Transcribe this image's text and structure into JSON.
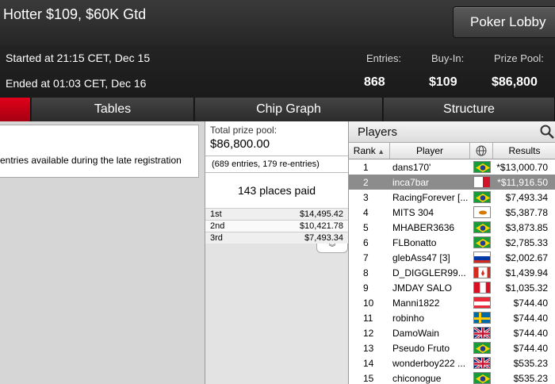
{
  "header": {
    "title": "Hotter $109, $60K Gtd",
    "lobby_button": "Poker Lobby",
    "started": "Started at 21:15 CET, Dec 15",
    "ended": "Ended at 01:03 CET, Dec 16",
    "stats": {
      "entries_label": "Entries:",
      "entries_value": "868",
      "buyin_label": "Buy-In:",
      "buyin_value": "$109",
      "prizepool_label": "Prize Pool:",
      "prizepool_value": "$86,800"
    }
  },
  "tabs": [
    {
      "label": ""
    },
    {
      "label": "Tables"
    },
    {
      "label": "Chip Graph"
    },
    {
      "label": "Structure"
    }
  ],
  "late_reg": {
    "text": "entries available during the late registration"
  },
  "prize_pool": {
    "label": "Total prize pool:",
    "value": "$86,800.00",
    "entries": "(689 entries, 179 re-entries)",
    "places_paid": "143 places paid",
    "payouts": [
      {
        "place": "1st",
        "amount": "$14,495.42"
      },
      {
        "place": "2nd",
        "amount": "$10,421.78"
      },
      {
        "place": "3rd",
        "amount": "$7,493.34"
      }
    ],
    "expand_glyph": "︾"
  },
  "players": {
    "title": "Players",
    "columns": {
      "rank": "Rank",
      "player": "Player",
      "results": "Results"
    },
    "rows": [
      {
        "rank": "1",
        "name": "dans170'",
        "flag": "brazil",
        "result": "*$13,000.70"
      },
      {
        "rank": "2",
        "name": "inca7bar",
        "flag": "malta",
        "result": "*$11,916.50"
      },
      {
        "rank": "3",
        "name": "RacingForever [...",
        "flag": "brazil",
        "result": "$7,493.34"
      },
      {
        "rank": "4",
        "name": "MITS 304",
        "flag": "cyprus",
        "result": "$5,387.78"
      },
      {
        "rank": "5",
        "name": "MHABER3636",
        "flag": "brazil",
        "result": "$3,873.85"
      },
      {
        "rank": "6",
        "name": "FLBonatto",
        "flag": "brazil",
        "result": "$2,785.33"
      },
      {
        "rank": "7",
        "name": "glebAss47 [3]",
        "flag": "russia",
        "result": "$2,002.67"
      },
      {
        "rank": "8",
        "name": "D_DIGGLER99...",
        "flag": "canada",
        "result": "$1,439.94"
      },
      {
        "rank": "9",
        "name": "JMDAY SALO",
        "flag": "peru",
        "result": "$1,035.32"
      },
      {
        "rank": "10",
        "name": "Manni1822",
        "flag": "austria",
        "result": "$744.40"
      },
      {
        "rank": "11",
        "name": "robinho",
        "flag": "sweden",
        "result": "$744.40"
      },
      {
        "rank": "12",
        "name": "DamoWain",
        "flag": "uk",
        "result": "$744.40"
      },
      {
        "rank": "13",
        "name": "Pseudo Fruto",
        "flag": "brazil",
        "result": "$744.40"
      },
      {
        "rank": "14",
        "name": "wonderboy222 ...",
        "flag": "uk",
        "result": "$535.23"
      },
      {
        "rank": "15",
        "name": "chiconogue",
        "flag": "brazil",
        "result": "$535.23"
      }
    ]
  },
  "colors": {
    "accent_red": "#d10018",
    "selected_row": "#8c8c8c"
  }
}
